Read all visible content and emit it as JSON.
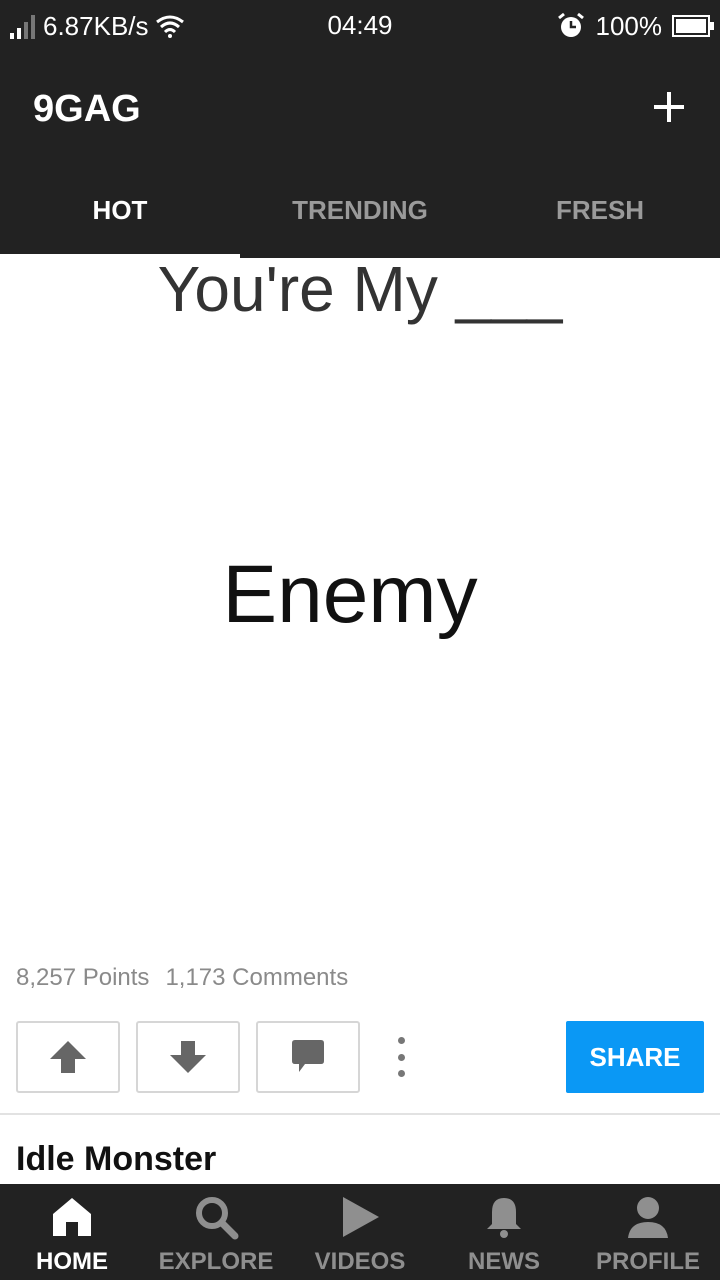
{
  "status_bar": {
    "net_speed": "6.87KB/s",
    "time": "04:49",
    "battery": "100%",
    "icons": [
      "signal-icon",
      "wifi-icon",
      "alarm-icon",
      "battery-icon"
    ]
  },
  "app_bar": {
    "title": "9GAG",
    "add_icon": "plus-icon"
  },
  "tabs": [
    {
      "label": "HOT",
      "active": true
    },
    {
      "label": "TRENDING",
      "active": false
    },
    {
      "label": "FRESH",
      "active": false
    }
  ],
  "post": {
    "image_top_text": "You're My ___",
    "image_main_text": "Enemy",
    "points": "8,257 Points",
    "comments": "1,173 Comments",
    "share_label": "SHARE",
    "action_icons": [
      "upvote-icon",
      "downvote-icon",
      "comment-icon",
      "more-icon"
    ]
  },
  "next_post": {
    "title": "Idle Monster"
  },
  "bottom_nav": [
    {
      "label": "HOME",
      "icon": "home-icon",
      "active": true
    },
    {
      "label": "EXPLORE",
      "icon": "search-icon",
      "active": false
    },
    {
      "label": "VIDEOS",
      "icon": "play-icon",
      "active": false
    },
    {
      "label": "NEWS",
      "icon": "bell-icon",
      "active": false
    },
    {
      "label": "PROFILE",
      "icon": "profile-icon",
      "active": false
    }
  ],
  "colors": {
    "bar_background": "#222222",
    "share_button": "#0a98f5",
    "inactive_text": "#8f8f8f"
  }
}
